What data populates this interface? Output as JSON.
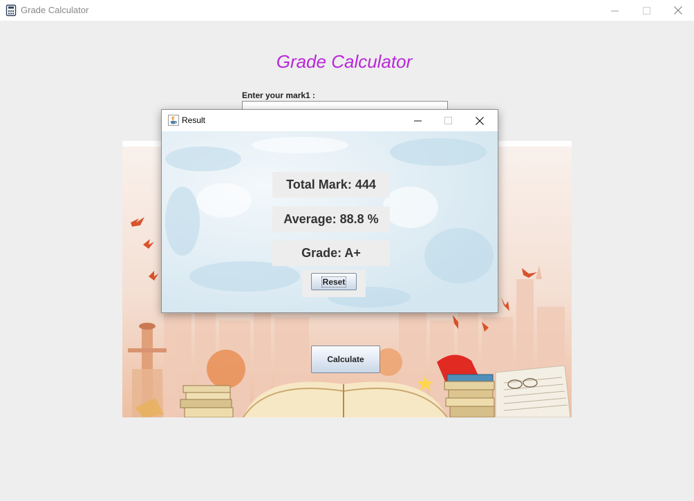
{
  "window": {
    "title": "Grade Calculator",
    "icon": "calculator-app-icon"
  },
  "main": {
    "heading": "Grade Calculator",
    "heading_color": "#b827d9",
    "mark1_label": "Enter your mark1 :",
    "mark1_value": "",
    "calculate_label": "Calculate",
    "background_image": "books-and-city-skyline-illustration"
  },
  "dialog": {
    "title": "Result",
    "icon": "java-cup-icon",
    "total_mark": "Total Mark: 444",
    "average": "Average: 88.8 %",
    "grade": "Grade: A+",
    "reset_label": "Reset",
    "background_image": "light-blue-marble-texture"
  }
}
